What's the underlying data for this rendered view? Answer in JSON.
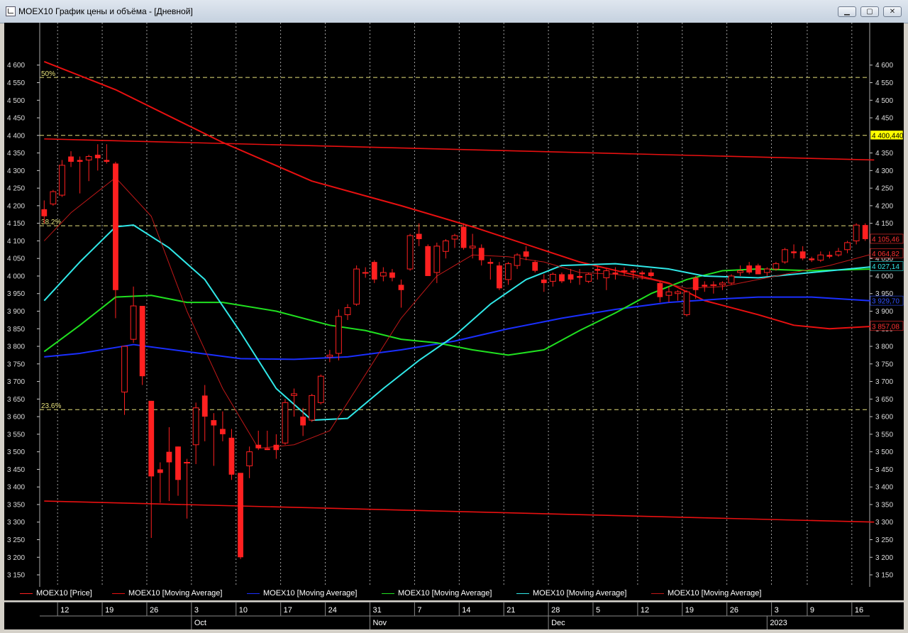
{
  "window": {
    "title": "MOEX10 График цены и объёма - [Дневной]",
    "minimize_label": "▁",
    "maximize_label": "▢",
    "close_label": "✕"
  },
  "colors": {
    "background": "#000000",
    "candle": "#ff2020",
    "trend": "#e81010",
    "ma_fast": "#c01818",
    "ma_blue": "#1a2fff",
    "ma_green": "#20e020",
    "ma_cyan": "#30e8e8",
    "fib": "#e6e07a",
    "grid": "#c8c8c8"
  },
  "chart_data": {
    "type": "candlestick",
    "title": "MOEX10",
    "ylim": [
      3140,
      4660
    ],
    "yticks": [
      3150,
      3200,
      3250,
      3300,
      3350,
      3400,
      3450,
      3500,
      3550,
      3600,
      3650,
      3700,
      3750,
      3800,
      3850,
      3900,
      3950,
      4000,
      4050,
      4100,
      4150,
      4200,
      4250,
      4300,
      4350,
      4400,
      4450,
      4500,
      4550,
      4600
    ],
    "ytick_labels": [
      "3 150",
      "3 200",
      "3 250",
      "3 300",
      "3 350",
      "3 400",
      "3 450",
      "3 500",
      "3 550",
      "3 600",
      "3 650",
      "3 700",
      "3 750",
      "3 800",
      "3 850",
      "3 900",
      "3 950",
      "4 000",
      "4 050",
      "4 100",
      "4 150",
      "4 200",
      "4 250",
      "4 300",
      "4 350",
      "4 400",
      "4 450",
      "4 500",
      "4 550",
      "4 600"
    ],
    "x_day_labels": [
      "12",
      "19",
      "26",
      "3",
      "10",
      "17",
      "24",
      "31",
      "7",
      "14",
      "21",
      "28",
      "5",
      "12",
      "19",
      "26",
      "3",
      "9",
      "16"
    ],
    "x_day_label_slots": [
      2,
      7,
      12,
      17,
      22,
      27,
      32,
      37,
      42,
      47,
      52,
      57,
      62,
      67,
      72,
      77,
      82,
      86,
      91
    ],
    "x_month_labels": [
      "Oct",
      "Nov",
      "Dec",
      "2023"
    ],
    "x_month_label_slots": [
      17,
      37,
      57,
      81.5
    ],
    "num_slots": 93,
    "candles": [
      {
        "o": 4190,
        "h": 4215,
        "l": 4150,
        "c": 4170
      },
      {
        "o": 4205,
        "h": 4245,
        "l": 4200,
        "c": 4240
      },
      {
        "o": 4230,
        "h": 4330,
        "l": 4225,
        "c": 4315
      },
      {
        "o": 4340,
        "h": 4355,
        "l": 4310,
        "c": 4325
      },
      {
        "o": 4330,
        "h": 4340,
        "l": 4235,
        "c": 4325
      },
      {
        "o": 4330,
        "h": 4345,
        "l": 4270,
        "c": 4340
      },
      {
        "o": 4345,
        "h": 4375,
        "l": 4300,
        "c": 4335
      },
      {
        "o": 4330,
        "h": 4375,
        "l": 4320,
        "c": 4325
      },
      {
        "o": 4320,
        "h": 4325,
        "l": 3880,
        "c": 3960
      },
      {
        "o": 3670,
        "h": 3800,
        "l": 3605,
        "c": 3800
      },
      {
        "o": 3820,
        "h": 3970,
        "l": 3810,
        "c": 3915
      },
      {
        "o": 3915,
        "h": 3915,
        "l": 3690,
        "c": 3715
      },
      {
        "o": 3645,
        "h": 3645,
        "l": 3255,
        "c": 3430
      },
      {
        "o": 3450,
        "h": 3470,
        "l": 3355,
        "c": 3440
      },
      {
        "o": 3500,
        "h": 3570,
        "l": 3360,
        "c": 3470
      },
      {
        "o": 3515,
        "h": 3515,
        "l": 3375,
        "c": 3420
      },
      {
        "o": 3470,
        "h": 3480,
        "l": 3310,
        "c": 3470
      },
      {
        "o": 3520,
        "h": 3640,
        "l": 3465,
        "c": 3625
      },
      {
        "o": 3660,
        "h": 3690,
        "l": 3530,
        "c": 3600
      },
      {
        "o": 3590,
        "h": 3610,
        "l": 3460,
        "c": 3575
      },
      {
        "o": 3565,
        "h": 3615,
        "l": 3530,
        "c": 3550
      },
      {
        "o": 3540,
        "h": 3565,
        "l": 3420,
        "c": 3435
      },
      {
        "o": 3440,
        "h": 3440,
        "l": 3195,
        "c": 3200
      },
      {
        "o": 3460,
        "h": 3515,
        "l": 3425,
        "c": 3500
      },
      {
        "o": 3520,
        "h": 3560,
        "l": 3505,
        "c": 3510
      },
      {
        "o": 3510,
        "h": 3560,
        "l": 3505,
        "c": 3505
      },
      {
        "o": 3520,
        "h": 3550,
        "l": 3480,
        "c": 3505
      },
      {
        "o": 3525,
        "h": 3650,
        "l": 3520,
        "c": 3640
      },
      {
        "o": 3660,
        "h": 3680,
        "l": 3600,
        "c": 3665
      },
      {
        "o": 3600,
        "h": 3625,
        "l": 3545,
        "c": 3575
      },
      {
        "o": 3590,
        "h": 3665,
        "l": 3585,
        "c": 3660
      },
      {
        "o": 3640,
        "h": 3720,
        "l": 3635,
        "c": 3715
      },
      {
        "o": 3770,
        "h": 3790,
        "l": 3755,
        "c": 3775
      },
      {
        "o": 3780,
        "h": 3905,
        "l": 3760,
        "c": 3885
      },
      {
        "o": 3890,
        "h": 3920,
        "l": 3875,
        "c": 3910
      },
      {
        "o": 3920,
        "h": 4030,
        "l": 3915,
        "c": 4020
      },
      {
        "o": 4010,
        "h": 4025,
        "l": 3995,
        "c": 4010
      },
      {
        "o": 4040,
        "h": 4045,
        "l": 3980,
        "c": 3990
      },
      {
        "o": 4000,
        "h": 4025,
        "l": 3985,
        "c": 4010
      },
      {
        "o": 4010,
        "h": 4020,
        "l": 3985,
        "c": 3995
      },
      {
        "o": 3975,
        "h": 3990,
        "l": 3910,
        "c": 3960
      },
      {
        "o": 4020,
        "h": 4120,
        "l": 4015,
        "c": 4115
      },
      {
        "o": 4120,
        "h": 4150,
        "l": 4085,
        "c": 4105
      },
      {
        "o": 4085,
        "h": 4090,
        "l": 4000,
        "c": 4000
      },
      {
        "o": 4010,
        "h": 4095,
        "l": 3980,
        "c": 4085
      },
      {
        "o": 4070,
        "h": 4105,
        "l": 4050,
        "c": 4100
      },
      {
        "o": 4105,
        "h": 4120,
        "l": 4080,
        "c": 4115
      },
      {
        "o": 4140,
        "h": 4150,
        "l": 4075,
        "c": 4080
      },
      {
        "o": 4080,
        "h": 4120,
        "l": 4050,
        "c": 4085
      },
      {
        "o": 4080,
        "h": 4090,
        "l": 4030,
        "c": 4045
      },
      {
        "o": 4040,
        "h": 4050,
        "l": 3990,
        "c": 4035
      },
      {
        "o": 4030,
        "h": 4040,
        "l": 3960,
        "c": 3965
      },
      {
        "o": 3990,
        "h": 4040,
        "l": 3975,
        "c": 4035
      },
      {
        "o": 4030,
        "h": 4065,
        "l": 4020,
        "c": 4060
      },
      {
        "o": 4070,
        "h": 4085,
        "l": 4045,
        "c": 4055
      },
      {
        "o": 4040,
        "h": 4045,
        "l": 4010,
        "c": 4015
      },
      {
        "o": 3990,
        "h": 4005,
        "l": 3955,
        "c": 3980
      },
      {
        "o": 3985,
        "h": 4010,
        "l": 3970,
        "c": 4005
      },
      {
        "o": 4005,
        "h": 4010,
        "l": 3980,
        "c": 3985
      },
      {
        "o": 4005,
        "h": 4020,
        "l": 3980,
        "c": 3990
      },
      {
        "o": 4000,
        "h": 4020,
        "l": 3975,
        "c": 3995
      },
      {
        "o": 3985,
        "h": 4010,
        "l": 3980,
        "c": 4005
      },
      {
        "o": 4020,
        "h": 4030,
        "l": 3990,
        "c": 4015
      },
      {
        "o": 3995,
        "h": 4020,
        "l": 3960,
        "c": 4015
      },
      {
        "o": 4010,
        "h": 4025,
        "l": 3990,
        "c": 4005
      },
      {
        "o": 4015,
        "h": 4025,
        "l": 4000,
        "c": 4015
      },
      {
        "o": 4015,
        "h": 4020,
        "l": 3990,
        "c": 4010
      },
      {
        "o": 4010,
        "h": 4015,
        "l": 3990,
        "c": 4005
      },
      {
        "o": 4010,
        "h": 4020,
        "l": 3995,
        "c": 4000
      },
      {
        "o": 3980,
        "h": 3985,
        "l": 3925,
        "c": 3940
      },
      {
        "o": 3945,
        "h": 3970,
        "l": 3925,
        "c": 3955
      },
      {
        "o": 3950,
        "h": 3960,
        "l": 3930,
        "c": 3955
      },
      {
        "o": 3890,
        "h": 3960,
        "l": 3885,
        "c": 3955
      },
      {
        "o": 3995,
        "h": 4000,
        "l": 3935,
        "c": 3960
      },
      {
        "o": 3975,
        "h": 3985,
        "l": 3955,
        "c": 3970
      },
      {
        "o": 3975,
        "h": 3985,
        "l": 3950,
        "c": 3975
      },
      {
        "o": 3975,
        "h": 3985,
        "l": 3960,
        "c": 3980
      },
      {
        "o": 3980,
        "h": 4005,
        "l": 3975,
        "c": 4000
      },
      {
        "o": 4010,
        "h": 4030,
        "l": 4000,
        "c": 4015
      },
      {
        "o": 4030,
        "h": 4040,
        "l": 4005,
        "c": 4010
      },
      {
        "o": 4030,
        "h": 4035,
        "l": 4005,
        "c": 4005
      },
      {
        "o": 4010,
        "h": 4025,
        "l": 4000,
        "c": 4020
      },
      {
        "o": 4020,
        "h": 4040,
        "l": 4015,
        "c": 4035
      },
      {
        "o": 4040,
        "h": 4080,
        "l": 4035,
        "c": 4075
      },
      {
        "o": 4070,
        "h": 4090,
        "l": 4050,
        "c": 4065
      },
      {
        "o": 4070,
        "h": 4085,
        "l": 4045,
        "c": 4050
      },
      {
        "o": 4050,
        "h": 4055,
        "l": 4040,
        "c": 4045
      },
      {
        "o": 4045,
        "h": 4070,
        "l": 4040,
        "c": 4060
      },
      {
        "o": 4060,
        "h": 4070,
        "l": 4050,
        "c": 4055
      },
      {
        "o": 4060,
        "h": 4080,
        "l": 4055,
        "c": 4070
      },
      {
        "o": 4075,
        "h": 4100,
        "l": 4065,
        "c": 4095
      },
      {
        "o": 4100,
        "h": 4150,
        "l": 4090,
        "c": 4145
      },
      {
        "o": 4145,
        "h": 4150,
        "l": 4100,
        "c": 4105
      }
    ],
    "overlays": {
      "trend_upper": [
        [
          0,
          4610
        ],
        [
          8,
          4530
        ],
        [
          20,
          4380
        ],
        [
          30,
          4270
        ],
        [
          40,
          4200
        ],
        [
          48,
          4140
        ],
        [
          60,
          4040
        ],
        [
          70,
          3980
        ],
        [
          74,
          3930
        ],
        [
          80,
          3890
        ],
        [
          84,
          3860
        ],
        [
          88,
          3850
        ],
        [
          93,
          3857
        ]
      ],
      "trend_top_flat": [
        [
          0,
          4390
        ],
        [
          93,
          4330
        ]
      ],
      "trend_bottom_flat": [
        [
          0,
          3360
        ],
        [
          93,
          3300
        ]
      ],
      "ma_fast": [
        [
          0,
          4100
        ],
        [
          3,
          4180
        ],
        [
          8,
          4280
        ],
        [
          12,
          4170
        ],
        [
          16,
          3900
        ],
        [
          20,
          3680
        ],
        [
          24,
          3510
        ],
        [
          28,
          3520
        ],
        [
          32,
          3560
        ],
        [
          36,
          3720
        ],
        [
          40,
          3880
        ],
        [
          44,
          4000
        ],
        [
          48,
          4060
        ],
        [
          52,
          4055
        ],
        [
          56,
          4040
        ],
        [
          60,
          4010
        ],
        [
          64,
          4005
        ],
        [
          68,
          3990
        ],
        [
          72,
          3965
        ],
        [
          76,
          3970
        ],
        [
          80,
          3990
        ],
        [
          84,
          4010
        ],
        [
          88,
          4030
        ],
        [
          93,
          4064
        ]
      ],
      "ma_blue": [
        [
          0,
          3770
        ],
        [
          4,
          3780
        ],
        [
          10,
          3805
        ],
        [
          16,
          3785
        ],
        [
          22,
          3765
        ],
        [
          28,
          3763
        ],
        [
          34,
          3770
        ],
        [
          40,
          3790
        ],
        [
          46,
          3815
        ],
        [
          52,
          3850
        ],
        [
          58,
          3880
        ],
        [
          64,
          3905
        ],
        [
          70,
          3925
        ],
        [
          76,
          3935
        ],
        [
          80,
          3940
        ],
        [
          86,
          3940
        ],
        [
          93,
          3929
        ]
      ],
      "ma_green": [
        [
          0,
          3785
        ],
        [
          4,
          3860
        ],
        [
          8,
          3940
        ],
        [
          12,
          3945
        ],
        [
          16,
          3925
        ],
        [
          20,
          3925
        ],
        [
          26,
          3900
        ],
        [
          32,
          3860
        ],
        [
          36,
          3845
        ],
        [
          40,
          3820
        ],
        [
          44,
          3810
        ],
        [
          48,
          3790
        ],
        [
          52,
          3775
        ],
        [
          56,
          3790
        ],
        [
          60,
          3845
        ],
        [
          64,
          3895
        ],
        [
          68,
          3950
        ],
        [
          72,
          3990
        ],
        [
          76,
          4015
        ],
        [
          80,
          4020
        ],
        [
          86,
          4015
        ],
        [
          93,
          4020
        ]
      ],
      "ma_cyan": [
        [
          0,
          3930
        ],
        [
          4,
          4040
        ],
        [
          8,
          4140
        ],
        [
          10,
          4145
        ],
        [
          14,
          4080
        ],
        [
          18,
          3990
        ],
        [
          22,
          3840
        ],
        [
          26,
          3680
        ],
        [
          30,
          3590
        ],
        [
          34,
          3595
        ],
        [
          38,
          3680
        ],
        [
          42,
          3760
        ],
        [
          46,
          3830
        ],
        [
          50,
          3920
        ],
        [
          54,
          3990
        ],
        [
          58,
          4030
        ],
        [
          64,
          4035
        ],
        [
          70,
          4020
        ],
        [
          74,
          4000
        ],
        [
          80,
          3995
        ],
        [
          86,
          4010
        ],
        [
          93,
          4027
        ]
      ],
      "fib_levels": [
        {
          "value": 4565,
          "label": "50%"
        },
        {
          "value": 4400,
          "label": ""
        },
        {
          "value": 4143,
          "label": "38.2%"
        },
        {
          "value": 3620,
          "label": "23.6%"
        }
      ],
      "price_tags": [
        {
          "value": 4400,
          "label": "4 400,440",
          "bg": "#ffff00",
          "fg": "#000000"
        },
        {
          "value": 4105,
          "label": "4 105,46",
          "bg": "#000000",
          "fg": "#ff3030"
        },
        {
          "value": 4064,
          "label": "4 064,82",
          "bg": "#000000",
          "fg": "#ff3030"
        },
        {
          "value": 4027,
          "label": "4 027,14",
          "bg": "#000000",
          "fg": "#30e8e8"
        },
        {
          "value": 3929,
          "label": "3 929,70",
          "bg": "#000000",
          "fg": "#3050ff"
        },
        {
          "value": 3857,
          "label": "3 857,08",
          "bg": "#000000",
          "fg": "#ff3030"
        }
      ]
    },
    "legend": [
      {
        "label": "MOEX10 [Price]",
        "color": "#ff2020"
      },
      {
        "label": "MOEX10 [Moving Average]",
        "color": "#e81010"
      },
      {
        "label": "MOEX10 [Moving Average]",
        "color": "#1a2fff"
      },
      {
        "label": "MOEX10 [Moving Average]",
        "color": "#20e020"
      },
      {
        "label": "MOEX10 [Moving Average]",
        "color": "#30e8e8"
      },
      {
        "label": "MOEX10 [Moving Average]",
        "color": "#c01818"
      }
    ]
  }
}
